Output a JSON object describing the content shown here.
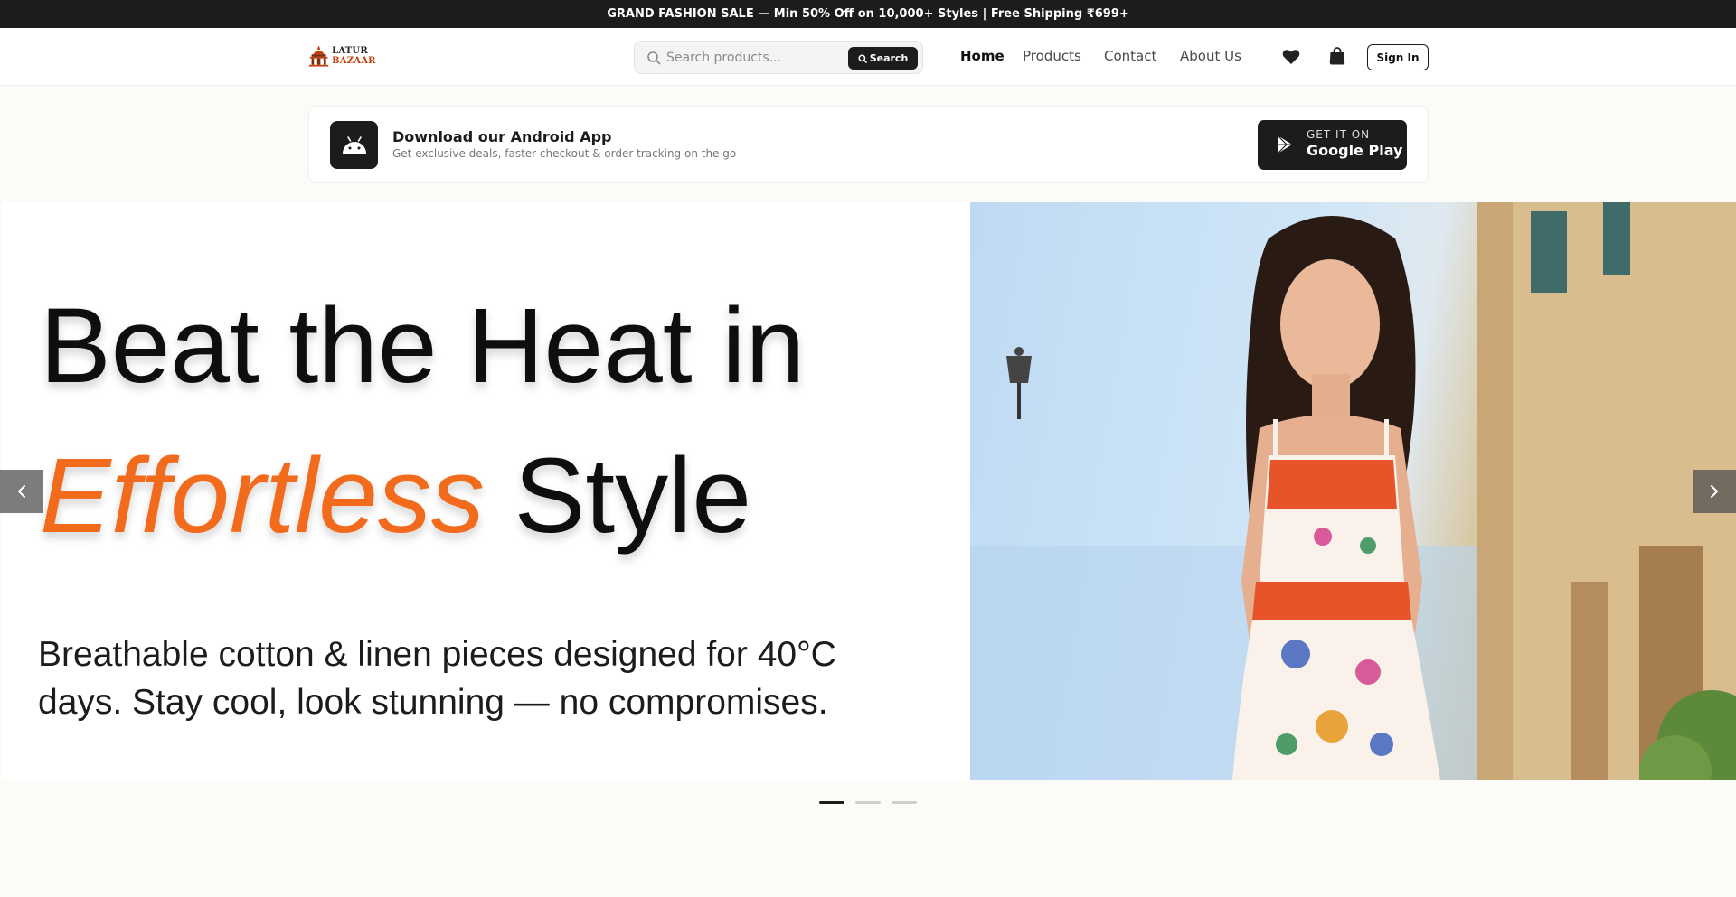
{
  "announcement": "GRAND FASHION SALE — Min 50% Off on 10,000+ Styles | Free Shipping ₹699+",
  "header": {
    "logo_text_a": "LATUR",
    "logo_text_b": "BAZAAR",
    "search_placeholder": "Search products...",
    "search_button": "Search",
    "nav": [
      "Home",
      "Products",
      "Contact",
      "About Us"
    ],
    "signin": "Sign In",
    "icons": [
      "heart-icon",
      "shopping-bag-icon",
      "search-icon"
    ]
  },
  "app_banner": {
    "title": "Download our Android App",
    "subtitle": "Get exclusive deals, faster checkout & order tracking on the go",
    "store_small": "GET IT ON",
    "store_big": "Google Play"
  },
  "hero": {
    "line1": "Beat the Heat in",
    "accent": "Effortless",
    "line2_rest": "Style",
    "description": "Breathable cotton & linen pieces designed for 40°C days. Stay cool, look stunning — no compromises.",
    "active_slide": 1,
    "slide_count": 3
  },
  "colors": {
    "dark": "#1c1c1c",
    "accent": "#f26a1b",
    "page_bg": "#fcfbf7"
  }
}
